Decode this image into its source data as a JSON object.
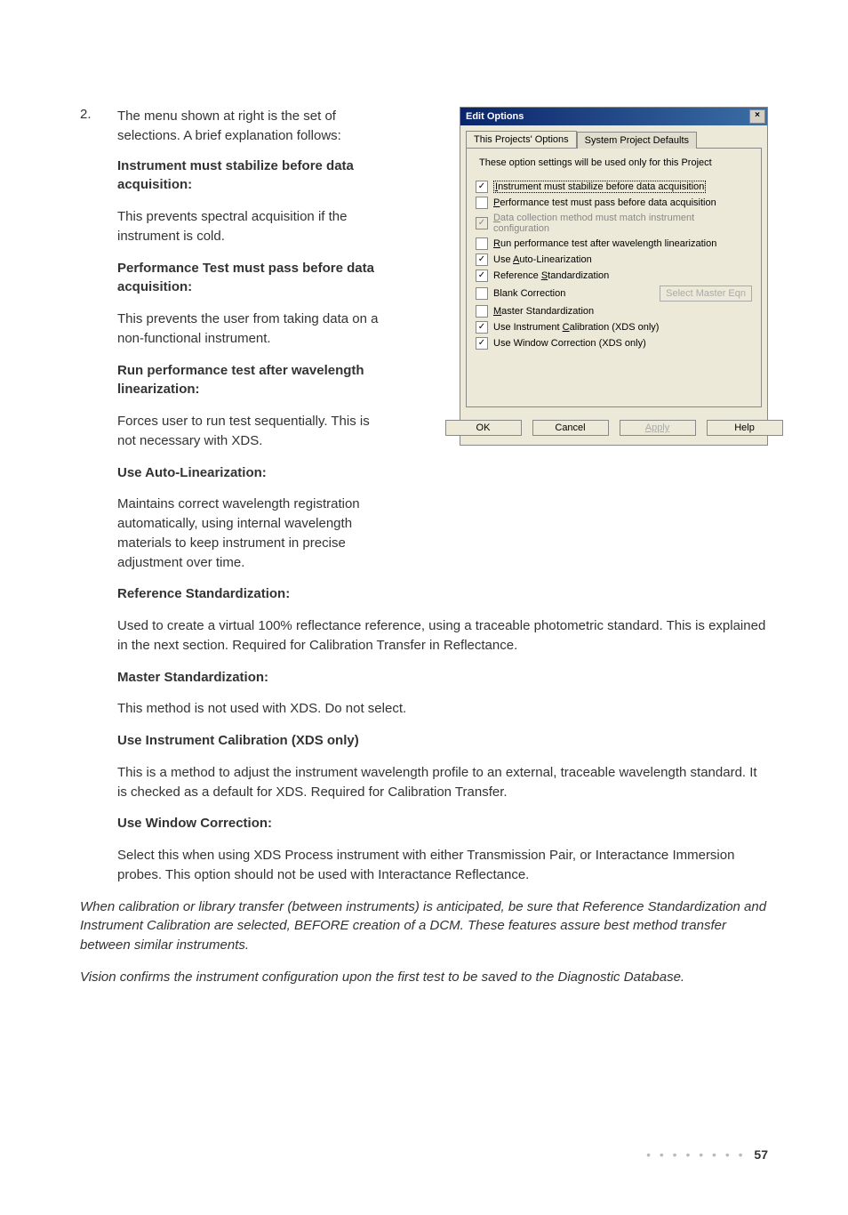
{
  "doc": {
    "item_num": "2.",
    "intro": "The menu shown at right is the set of selections. A brief explanation follows:",
    "h1": "Instrument must stabilize before data acquisition:",
    "p1": "This prevents spectral acquisition if the instrument is cold.",
    "h2": "Performance Test must pass before data acquisition:",
    "p2": "This prevents the user from taking data on a non-functional instrument.",
    "h3": "Run performance test after wavelength linearization:",
    "p3": "Forces user to run test sequentially. This is not necessary with XDS.",
    "h4": "Use Auto-Linearization:",
    "p4": "Maintains correct wavelength registration automatically, using internal wavelength materials to keep instrument in precise adjustment over time.",
    "h5": "Reference Standardization:",
    "p5": "Used to create a virtual 100% reflectance reference, using a traceable photometric standard. This is explained in the next section. Required for Calibration Transfer in Reflectance.",
    "h6": "Master Standardization:",
    "p6": "This method is not used with XDS. Do not select.",
    "h7": "Use Instrument Calibration (XDS only)",
    "p7": "This is a method to adjust the instrument wavelength profile to an external, traceable wavelength standard. It is checked as a default for XDS. Required for Calibration Transfer.",
    "h8": "Use Window Correction:",
    "p8": "Select this when using XDS Process instrument with either Transmission Pair, or Interactance Immersion probes. This option should not be used with Interactance Reflectance.",
    "note1": "When calibration or library transfer (between instruments) is anticipated, be sure that Reference Standardization and Instrument Calibration are selected, BEFORE creation of a DCM. These features assure best method transfer between similar instruments.",
    "note2": "Vision confirms the instrument configuration upon the first test to be saved to the Diagnostic Database.",
    "page": "57"
  },
  "dialog": {
    "title": "Edit Options",
    "tab1": "This Projects' Options",
    "tab2": "System Project Defaults",
    "note": "These option settings will be used only for this Project",
    "options": [
      {
        "label_pre": "",
        "u": "I",
        "label_post": "nstrument must stabilize before data acquisition",
        "checked": true,
        "disabled": false,
        "focus": true
      },
      {
        "label_pre": "",
        "u": "P",
        "label_post": "erformance test must pass before data acquisition",
        "checked": false,
        "disabled": false,
        "focus": false
      },
      {
        "label_pre": "",
        "u": "D",
        "label_post": "ata collection method must match instrument configuration",
        "checked": true,
        "disabled": true,
        "focus": false
      },
      {
        "label_pre": "",
        "u": "R",
        "label_post": "un performance test after wavelength linearization",
        "checked": false,
        "disabled": false,
        "focus": false
      },
      {
        "label_pre": "Use ",
        "u": "A",
        "label_post": "uto-Linearization",
        "checked": true,
        "disabled": false,
        "focus": false
      },
      {
        "label_pre": "Reference ",
        "u": "S",
        "label_post": "tandardization",
        "checked": true,
        "disabled": false,
        "focus": false
      },
      {
        "label_pre": "Blank Correction",
        "u": "",
        "label_post": "",
        "checked": false,
        "disabled": false,
        "focus": false
      },
      {
        "label_pre": "",
        "u": "M",
        "label_post": "aster Standardization",
        "checked": false,
        "disabled": false,
        "focus": false
      },
      {
        "label_pre": "Use Instrument ",
        "u": "C",
        "label_post": "alibration (XDS only)",
        "checked": true,
        "disabled": false,
        "focus": false
      },
      {
        "label_pre": "Use Window Correction (XDS only)",
        "u": "",
        "label_post": "",
        "checked": true,
        "disabled": false,
        "focus": false
      }
    ],
    "select_master": "Select Master Eqn",
    "ok": "OK",
    "cancel": "Cancel",
    "apply": "Apply",
    "help": "Help"
  }
}
